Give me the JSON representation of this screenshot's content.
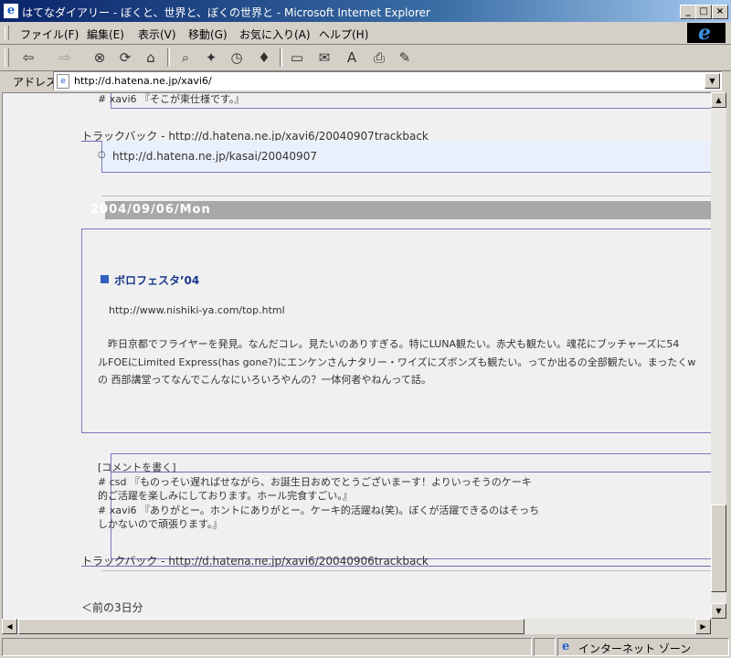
{
  "window": {
    "title": "はてなダイアリー - ぼくと、世界と、ぼくの世界と - Microsoft Internet Explorer",
    "minimize": "_",
    "maximize": "□",
    "close": "×"
  },
  "menu": [
    "ファイル(F)",
    "編集(E)",
    "表示(V)",
    "移動(G)",
    "お気に入り(A)",
    "ヘルプ(H)"
  ],
  "toolbar": {
    "back": "⇦",
    "forward": "⇨",
    "stop": "⊗",
    "refresh": "⟳",
    "home": "⌂",
    "search": "⌕",
    "favorites": "✦",
    "history": "◷",
    "channels": "♦",
    "fullscreen": "▭",
    "mail": "✉",
    "fonts": "A",
    "print": "⎙",
    "edit": "✎"
  },
  "address": {
    "label": "アドレス",
    "url": "http://d.hatena.ne.jp/xavi6/"
  },
  "page": {
    "top_fragment": "# xavi6 『そこが東仕様です。』",
    "trackback1_label": "トラックバック - http://d.hatena.ne.jp/xavi6/20040907trackback",
    "trackback1_item": "http://d.hatena.ne.jp/kasai/20040907",
    "date_header": "2004/09/06/Mon",
    "section_title": "ボロフェスタ’04",
    "section_url": "http://www.nishiki-ya.com/top.html",
    "body_line1": "　昨日京都でフライヤーを発見。なんだコレ。見たいのありすぎる。特にLUNA観たい。赤犬も観たい。魂花にブッチャーズに54",
    "body_line2": "ルFOEにLimited Express(has gone?)にエンケンさんナタリー・ワイズにズボンズも観たい。ってか出るの全部観たい。まったくw",
    "body_line3": "の 西部講堂ってなんでこんなにいろいろやんの？一体何者やねんって話。",
    "comment_link": "[コメントを書く]",
    "comment1_l1": "# csd 『ものっそい遅ればせながら、お誕生日おめでとうございまーす！よりいっそうのケーキ",
    "comment1_l2": "的ご活躍を楽しみにしております。ホール完食すごい。』",
    "comment2_l1": "# xavi6 『ありがとー。ホントにありがとー。ケーキ的活躍ね(笑)。ぼくが活躍できるのはそっち",
    "comment2_l2": "しかないので頑張ります。』",
    "trackback2_label": "トラックバック - http://d.hatena.ne.jp/xavi6/20040906trackback",
    "prev_link": "＜前の3日分"
  },
  "status": {
    "zone": "インターネット ゾーン"
  },
  "colors": {
    "titlebar": "#0a246a",
    "chrome": "#d4d0c8",
    "page_bg": "#f0f0f0",
    "accent_square": "#3060c0",
    "date_bar": "#a8a8a8"
  }
}
